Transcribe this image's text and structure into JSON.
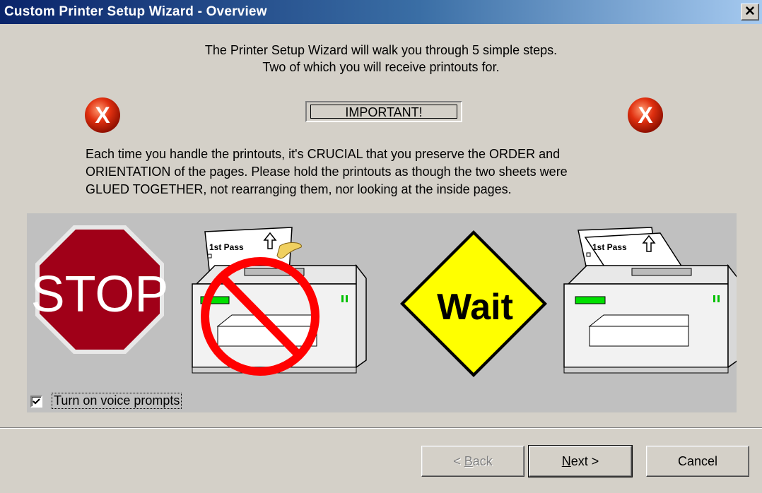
{
  "window": {
    "title": "Custom Printer Setup Wizard - Overview",
    "close_glyph": "✕"
  },
  "intro": {
    "line1": "The Printer Setup Wizard will walk you through 5 simple steps.",
    "line2": "Two of which you will receive printouts for."
  },
  "important_label": "IMPORTANT!",
  "instructions": [
    "Each time you handle the printouts, it's CRUCIAL that you preserve the ORDER and",
    "ORIENTATION of the pages.  Please hold the printouts as though the two sheets were",
    "GLUED TOGETHER, not rearranging them, nor looking at the inside pages."
  ],
  "illustration": {
    "stop_sign_text": "STOP",
    "wait_sign_text": "Wait",
    "paper_label": "1st Pass",
    "colors": {
      "stop_red": "#a00018",
      "wait_yellow": "#ffff00",
      "printer_body": "#f0f0f0",
      "printer_led": "#00e000",
      "prohibit_red": "#ff0000"
    }
  },
  "voice_prompts": {
    "label": "Turn on voice prompts",
    "checked": true
  },
  "buttons": {
    "back": {
      "prefix": "< ",
      "key": "B",
      "rest": "ack",
      "enabled": false
    },
    "next": {
      "key": "N",
      "rest": "ext >"
    },
    "cancel": "Cancel"
  }
}
